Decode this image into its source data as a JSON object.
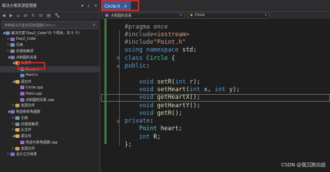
{
  "explorer": {
    "title": "解决方案资源管理器",
    "search_placeholder": "搜索解决方案资源管理器(Ctrl+;)",
    "tree": [
      {
        "label": "解决方案\"Day2_Code\"(5 个项目，共 5 个)",
        "indent": 0,
        "expanded": true,
        "icon": "solution"
      },
      {
        "label": "Day2_Code",
        "indent": 1,
        "expanded": false,
        "icon": "vc"
      },
      {
        "label": "引用",
        "indent": 1,
        "expanded": false,
        "icon": "ref"
      },
      {
        "label": "外部依赖项",
        "indent": 1,
        "expanded": false,
        "icon": "ext"
      },
      {
        "label": "点和圆的关系",
        "indent": 1,
        "expanded": true,
        "icon": "vc"
      },
      {
        "label": "头文件",
        "indent": 2,
        "expanded": true,
        "icon": "folder"
      },
      {
        "label": "Circle.h",
        "indent": 3,
        "expanded": false,
        "icon": "h",
        "selected": true
      },
      {
        "label": "Point.h",
        "indent": 3,
        "expanded": false,
        "icon": "h"
      },
      {
        "label": "源文件",
        "indent": 2,
        "expanded": true,
        "icon": "folder"
      },
      {
        "label": "Circle.cpp",
        "indent": 3,
        "expanded": false,
        "icon": "cpp"
      },
      {
        "label": "Point.cpp",
        "indent": 3,
        "expanded": false,
        "icon": "cpp"
      },
      {
        "label": "点和圆的关系.cpp",
        "indent": 3,
        "expanded": false,
        "icon": "cpp"
      },
      {
        "label": "资源文件",
        "indent": 2,
        "expanded": false,
        "icon": "res"
      },
      {
        "label": "构造和析构函数",
        "indent": 1,
        "expanded": true,
        "icon": "vc"
      },
      {
        "label": "引用",
        "indent": 2,
        "expanded": false,
        "icon": "ref"
      },
      {
        "label": "外部依赖项",
        "indent": 2,
        "expanded": false,
        "icon": "ext"
      },
      {
        "label": "头文件",
        "indent": 2,
        "expanded": false,
        "icon": "folder"
      },
      {
        "label": "源文件",
        "indent": 2,
        "expanded": true,
        "icon": "folder"
      },
      {
        "label": "构造与析构函数.cpp",
        "indent": 3,
        "expanded": false,
        "icon": "cpp"
      },
      {
        "label": "资源文件",
        "indent": 2,
        "expanded": false,
        "icon": "res"
      },
      {
        "label": "设计立方体类",
        "indent": 1,
        "expanded": false,
        "icon": "vc"
      }
    ]
  },
  "editor": {
    "tab": {
      "label": "Circle.h",
      "close": "×"
    },
    "nav": {
      "project": "点和圆的关系",
      "class": "Circle"
    },
    "code": [
      [
        [
          "pp",
          "#pragma once"
        ]
      ],
      [
        [
          "pp",
          "#include"
        ],
        [
          "st",
          "<iostream>"
        ]
      ],
      [
        [
          "pp",
          "#include"
        ],
        [
          "st",
          "\"Point.h\""
        ]
      ],
      [
        [
          "kw",
          "using namespace "
        ],
        [
          "pl",
          "std;"
        ]
      ],
      [
        [
          "kw",
          "class "
        ],
        [
          "ty",
          "Circle "
        ],
        [
          "pl",
          "{"
        ]
      ],
      [
        [
          "ac",
          "public"
        ],
        [
          "pl",
          ":"
        ]
      ],
      [
        [
          "pl",
          ""
        ]
      ],
      [
        [
          "pl",
          "    "
        ],
        [
          "kw",
          "void "
        ],
        [
          "fn",
          "setR"
        ],
        [
          "pl",
          "("
        ],
        [
          "kw",
          "int "
        ],
        [
          "nm",
          "r"
        ],
        [
          "pl",
          ");"
        ]
      ],
      [
        [
          "pl",
          "    "
        ],
        [
          "kw",
          "void "
        ],
        [
          "fn",
          "setHeart"
        ],
        [
          "pl",
          "("
        ],
        [
          "kw",
          "int "
        ],
        [
          "nm",
          "x"
        ],
        [
          "pl",
          ", "
        ],
        [
          "kw",
          "int "
        ],
        [
          "nm",
          "y"
        ],
        [
          "pl",
          ");"
        ]
      ],
      [
        [
          "pl",
          "    "
        ],
        [
          "kw",
          "void "
        ],
        [
          "fn",
          "getHeartX"
        ],
        [
          "pl",
          "();"
        ]
      ],
      [
        [
          "pl",
          "    "
        ],
        [
          "kw",
          "void "
        ],
        [
          "fn",
          "getHeartY"
        ],
        [
          "pl",
          "();"
        ]
      ],
      [
        [
          "pl",
          "    "
        ],
        [
          "kw",
          "void "
        ],
        [
          "fn",
          "getR"
        ],
        [
          "pl",
          "();"
        ]
      ],
      [
        [
          "ac",
          "private"
        ],
        [
          "pl",
          ":"
        ]
      ],
      [
        [
          "pl",
          "    "
        ],
        [
          "ty",
          "Point "
        ],
        [
          "pl",
          "heart;"
        ]
      ],
      [
        [
          "pl",
          "    "
        ],
        [
          "kw",
          "int "
        ],
        [
          "pl",
          "R;"
        ]
      ],
      [
        [
          "pl",
          "};"
        ]
      ]
    ]
  },
  "watermark": "CSDN @我沉默向前",
  "colors": {
    "accent_tab": "#3a5a99",
    "highlight_box": "#e0201b",
    "keyword": "#569cd6",
    "type": "#4ec9b0",
    "function": "#dcdcaa",
    "string": "#d69d85"
  }
}
